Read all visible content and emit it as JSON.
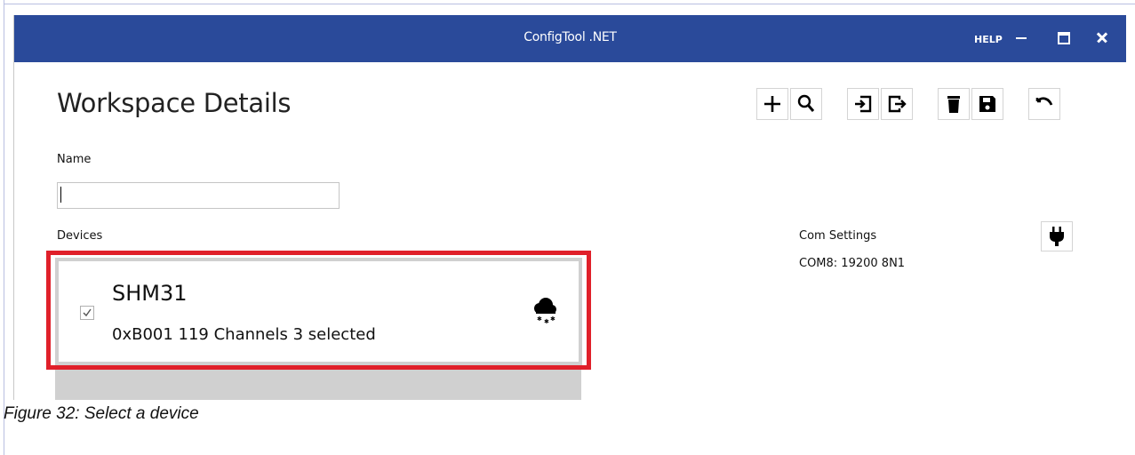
{
  "window": {
    "title": "ConfigTool .NET",
    "help_label": "HELP",
    "titlebar_color": "#2a4a9a"
  },
  "workspace": {
    "page_title": "Workspace Details",
    "name_label": "Name",
    "name_value": "",
    "devices_label": "Devices",
    "toolbar_icons": [
      "plus-icon",
      "search-icon",
      "import-icon",
      "export-icon",
      "trash-icon",
      "save-icon",
      "undo-icon"
    ]
  },
  "devices": [
    {
      "name": "SHM31",
      "info": "0xB001 119 Channels 3 selected",
      "checked": true,
      "status_icon": "snow-cloud-icon"
    }
  ],
  "com_settings": {
    "label": "Com Settings",
    "value": "COM8: 19200 8N1",
    "connect_icon": "plug-icon"
  },
  "caption": "Figure 32: Select a device",
  "highlight_color": "#e0202a"
}
